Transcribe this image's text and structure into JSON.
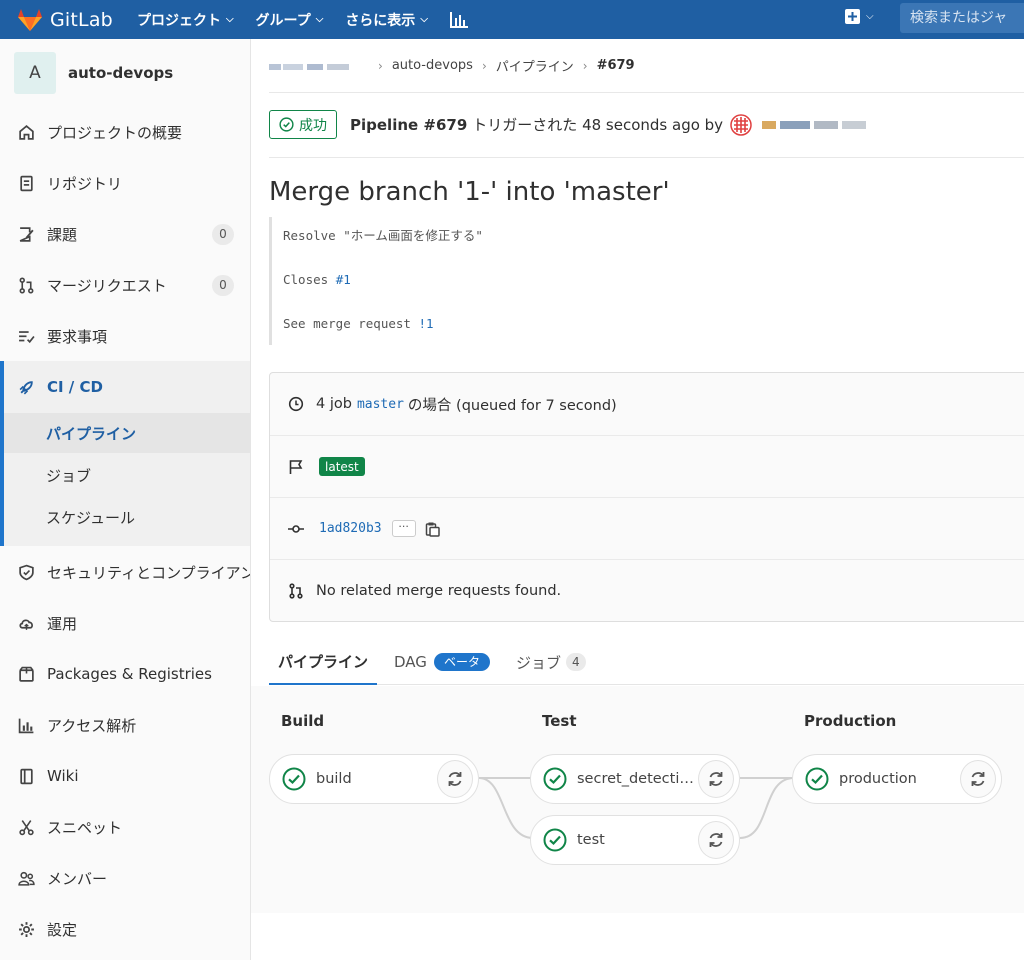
{
  "topbar": {
    "app_name": "GitLab",
    "nav": [
      "プロジェクト",
      "グループ",
      "さらに表示"
    ],
    "search_placeholder": "検索またはジャ"
  },
  "sidebar": {
    "project_initial": "A",
    "project_name": "auto-devops",
    "items": [
      {
        "label": "プロジェクトの概要",
        "icon": "home-icon"
      },
      {
        "label": "リポジトリ",
        "icon": "doc-icon"
      },
      {
        "label": "課題",
        "icon": "issues-icon",
        "count": "0"
      },
      {
        "label": "マージリクエスト",
        "icon": "merge-request-icon",
        "count": "0"
      },
      {
        "label": "要求事項",
        "icon": "requirements-icon"
      },
      {
        "label": "CI / CD",
        "icon": "rocket-icon"
      },
      {
        "label": "セキュリティとコンプライアンス",
        "icon": "shield-icon"
      },
      {
        "label": "運用",
        "icon": "cloud-icon"
      },
      {
        "label": "Packages & Registries",
        "icon": "package-icon"
      },
      {
        "label": "アクセス解析",
        "icon": "chart-icon"
      },
      {
        "label": "Wiki",
        "icon": "book-icon"
      },
      {
        "label": "スニペット",
        "icon": "scissors-icon"
      },
      {
        "label": "メンバー",
        "icon": "users-icon"
      },
      {
        "label": "設定",
        "icon": "gear-icon"
      }
    ],
    "cicd_sub": [
      "パイプライン",
      "ジョブ",
      "スケジュール"
    ]
  },
  "breadcrumb": {
    "project": "auto-devops",
    "section": "パイプライン",
    "current": "#679"
  },
  "pipeline": {
    "status": "成功",
    "id_label": "Pipeline #679",
    "triggered_text": "トリガーされた 48 seconds ago by",
    "title": "Merge branch '1-' into 'master'",
    "commit_lines": [
      {
        "text": "Resolve \"ホーム画面を修正する\""
      },
      {
        "text": "Closes ",
        "link": "#1"
      },
      {
        "text": "See merge request ",
        "link": "!1"
      }
    ],
    "jobs_count_text": "4 job",
    "branch": "master",
    "queued_text": "の場合 (queued for 7 second)",
    "latest_badge": "latest",
    "sha": "1ad820b3",
    "ellipsis": "···",
    "mr_text": "No related merge requests found."
  },
  "tabs": {
    "pipeline": "パイプライン",
    "dag": "DAG",
    "beta": "ベータ",
    "jobs": "ジョブ",
    "jobs_count": "4"
  },
  "stages": [
    {
      "title": "Build",
      "jobs": [
        "build"
      ]
    },
    {
      "title": "Test",
      "jobs": [
        "secret_detection_...",
        "test"
      ]
    },
    {
      "title": "Production",
      "jobs": [
        "production"
      ]
    }
  ],
  "colors": {
    "topbar": "#1f5fa3",
    "success": "#108548",
    "accent": "#1f75cb"
  }
}
